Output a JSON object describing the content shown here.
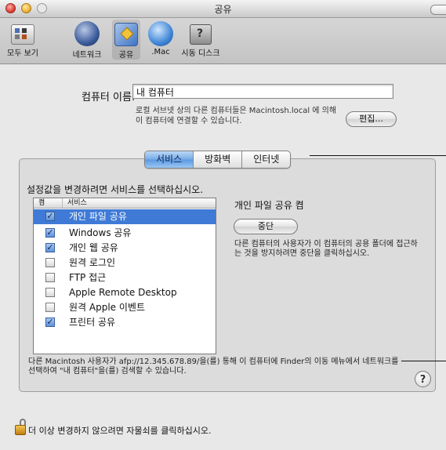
{
  "window": {
    "title": "공유"
  },
  "toolbar": {
    "items": [
      {
        "label": "모두 보기",
        "icon": "grid-icon"
      },
      {
        "label": "네트워크",
        "icon": "network-globe-icon"
      },
      {
        "label": "공유",
        "icon": "sharing-folder-icon",
        "selected": true
      },
      {
        "label": ".Mac",
        "icon": "dotmac-globe-icon"
      },
      {
        "label": "시동 디스크",
        "icon": "startup-disk-icon"
      }
    ]
  },
  "computer_name": {
    "label": "컴퓨터 이름:",
    "value": "내 컴퓨터",
    "hint": "로컬 서브넷 상의 다른 컴퓨터들은 Macintosh.local 에 의해 이 컴퓨터에 연결할 수 있습니다.",
    "edit_button": "편집..."
  },
  "tabs": [
    {
      "label": "서비스",
      "active": true
    },
    {
      "label": "방화벽",
      "active": false
    },
    {
      "label": "인터넷",
      "active": false
    }
  ],
  "services": {
    "instruction": "설정값을 변경하려면 서비스를 선택하십시오.",
    "columns": {
      "on": "켬",
      "service": "서비스"
    },
    "rows": [
      {
        "label": "개인 파일 공유",
        "checked": true,
        "selected": true
      },
      {
        "label": "Windows 공유",
        "checked": true,
        "selected": false
      },
      {
        "label": "개인 웹 공유",
        "checked": true,
        "selected": false
      },
      {
        "label": "원격 로그인",
        "checked": false,
        "selected": false
      },
      {
        "label": "FTP 접근",
        "checked": false,
        "selected": false
      },
      {
        "label": "Apple Remote Desktop",
        "checked": false,
        "selected": false
      },
      {
        "label": "원격 Apple 이벤트",
        "checked": false,
        "selected": false
      },
      {
        "label": "프린터 공유",
        "checked": true,
        "selected": false
      }
    ],
    "detail": {
      "status": "개인 파일 공유 켬",
      "stop_button": "중단",
      "description": "다른 컴퓨터의 사용자가 이 컴퓨터의 공용 폴더에 접근하는 것을 방지하려면 중단을 클릭하십시오."
    },
    "bottom_note": "다른 Macintosh 사용자가 afp://12.345.678.89/을(를) 통해 이 컴퓨터에 Finder의 이동 메뉴에서 네트워크를 선택하여 \"내 컴퓨터\"을(를) 검색할 수 있습니다.",
    "help": "?"
  },
  "lock": {
    "text": "더 이상 변경하지 않으려면 자물쇠를 클릭하십시오.",
    "state": "unlocked"
  }
}
